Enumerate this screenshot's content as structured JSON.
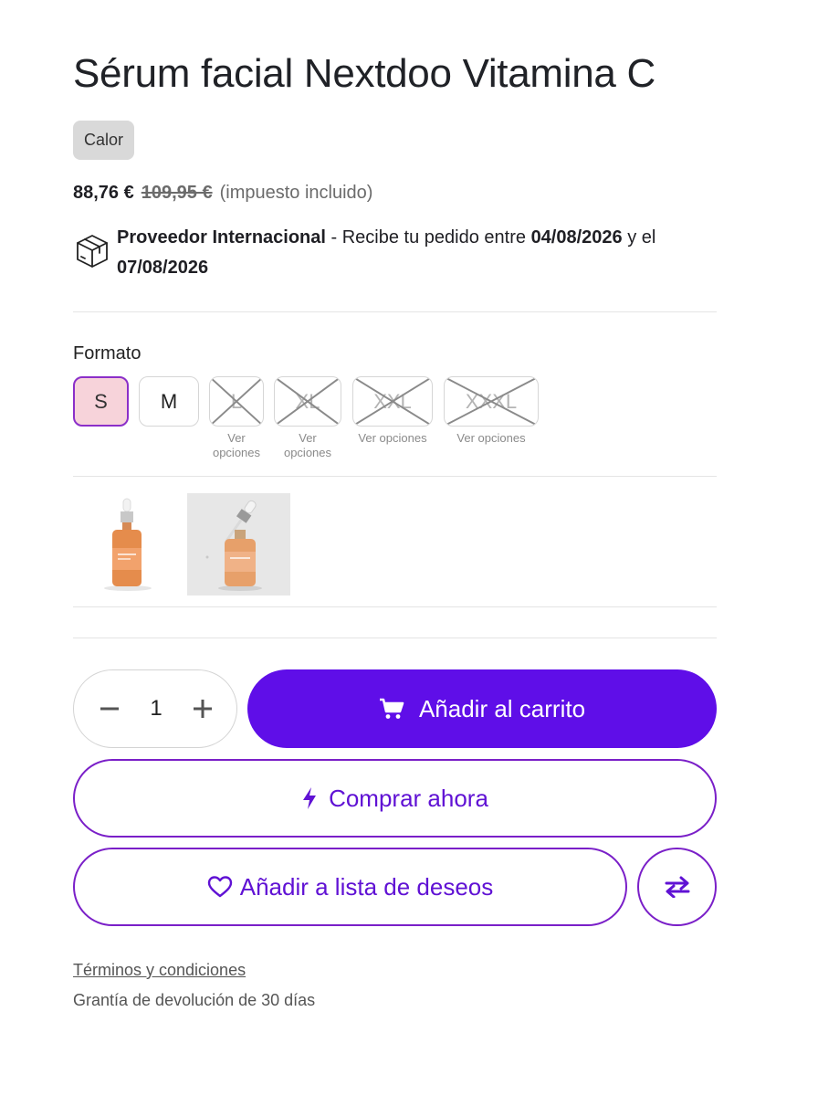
{
  "product": {
    "title": "Sérum facial Nextdoo Vitamina C",
    "tag": "Calor"
  },
  "pricing": {
    "current": "88,76 €",
    "original": "109,95 €",
    "tax_note": "(impuesto incluido)"
  },
  "shipping": {
    "supplier": "Proveedor Internacional",
    "text_mid": " - Recibe tu pedido entre ",
    "date_from": "04/08/2026",
    "text_and": " y el ",
    "date_to": "07/08/2026",
    "icon": "package-icon"
  },
  "format": {
    "label": "Formato",
    "options": [
      {
        "label": "S",
        "state": "selected"
      },
      {
        "label": "M",
        "state": "available"
      },
      {
        "label": "L",
        "state": "unavailable",
        "note": "Ver opciones"
      },
      {
        "label": "XL",
        "state": "unavailable",
        "note": "Ver opciones"
      },
      {
        "label": "XXL",
        "state": "unavailable",
        "note": "Ver opciones"
      },
      {
        "label": "XXXL",
        "state": "unavailable",
        "note": "Ver opciones"
      }
    ]
  },
  "gallery": {
    "images": [
      "serum-bottle",
      "serum-bottle-with-dropper"
    ]
  },
  "purchase": {
    "quantity": "1",
    "add_to_cart": "Añadir al carrito",
    "buy_now": "Comprar ahora",
    "wishlist": "Añadir a lista de deseos"
  },
  "footer": {
    "terms": "Términos y condiciones",
    "warranty": "Grantía de devolución de 30 días"
  },
  "colors": {
    "accent": "#5f0ee8",
    "accent_border": "#7a1fc8",
    "selected_fill": "#f7d3da"
  }
}
